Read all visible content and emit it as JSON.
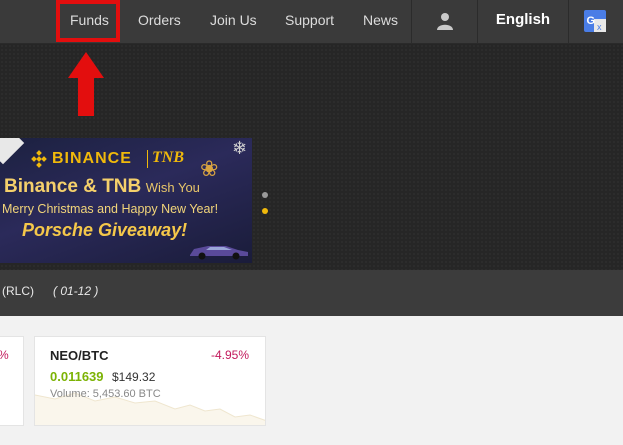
{
  "nav": {
    "items": [
      "Funds",
      "Orders",
      "Join Us",
      "Support",
      "News"
    ],
    "language": "English",
    "icons": {
      "user": "user-icon",
      "translate": "google-translate-icon"
    }
  },
  "banner": {
    "brand": "BINANCE",
    "partner": "TNB",
    "line1_big": "Binance & TNB",
    "line1_small": "Wish You",
    "line2": "Merry Christmas and Happy New Year!",
    "line3": "Porsche Giveaway!"
  },
  "strip": {
    "item1": "(RLC)",
    "item2": "( 01-12 )"
  },
  "cards": {
    "left_change": "%",
    "main": {
      "pair": "NEO/BTC",
      "change": "-4.95%",
      "price": "0.011639",
      "fiat": "$149.32",
      "volume": "Volume: 5,453.60 BTC"
    }
  },
  "colors": {
    "highlight": "#e30e0e",
    "accent": "#f0b90b",
    "positive_price": "#7cb305",
    "negative_change": "#c2185b"
  }
}
